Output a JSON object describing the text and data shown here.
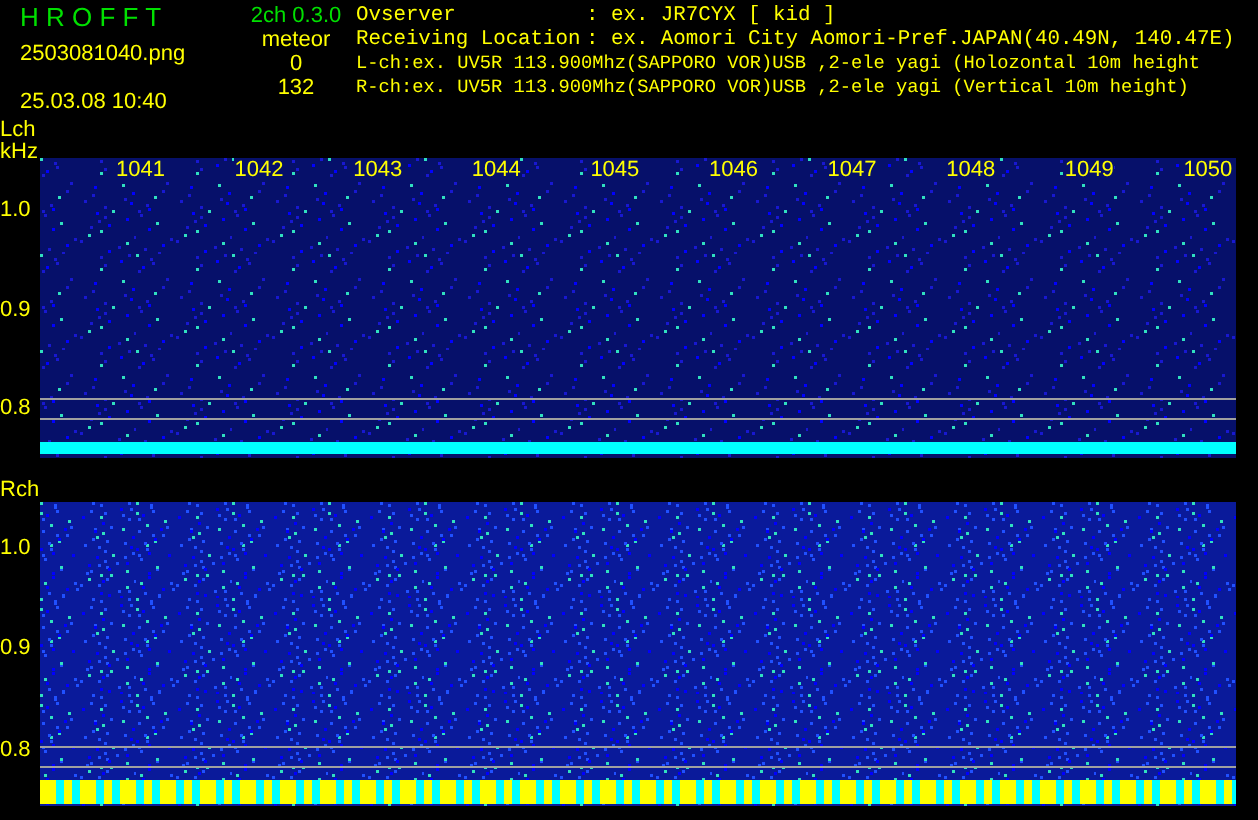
{
  "app": {
    "title": "H R O F F T",
    "version": "2ch 0.3.0",
    "filename": "2503081040.png",
    "timestamp": "25.03.08 10:40"
  },
  "meteor": {
    "label": "meteor",
    "counts": [
      "0",
      "132"
    ]
  },
  "info": [
    {
      "label": "Ovserver",
      "value": ": ex. JR7CYX [ kid ]"
    },
    {
      "label": "Receiving Location",
      "value": ": ex. Aomori City Aomori-Pref.JAPAN(40.49N, 140.47E)"
    }
  ],
  "channel_lines": [
    "L-ch:ex. UV5R 113.900Mhz(SAPPORO VOR)USB ,2-ele yagi (Holozontal 10m height",
    "R-ch:ex. UV5R 113.900Mhz(SAPPORO VOR)USB ,2-ele yagi (Vertical 10m height)"
  ],
  "time_axis": [
    "1041",
    "1042",
    "1043",
    "1044",
    "1045",
    "1046",
    "1047",
    "1048",
    "1049",
    "1050"
  ],
  "panels": [
    {
      "label": "Lch",
      "unit": "kHz",
      "kind": "trace",
      "yticks": [
        "1.0",
        "0.9",
        "0.8"
      ]
    },
    {
      "label": "Rch",
      "kind": "meteor",
      "yticks": [
        "1.0",
        "0.9",
        "0.8"
      ]
    }
  ]
}
